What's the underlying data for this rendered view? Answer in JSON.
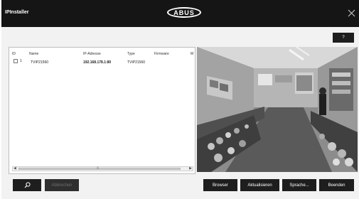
{
  "window": {
    "title": "IPInstaller",
    "logo_text": "ABUS",
    "close_icon": "close-x-icon"
  },
  "toolbar": {
    "help_label": "?"
  },
  "device_table": {
    "columns": [
      "ID",
      "Name",
      "IP-Adresse",
      "Type",
      "Firmware",
      "M"
    ],
    "rows": [
      {
        "id": "1",
        "name": "TVIP21560",
        "ip": "192.168.178.1:80",
        "type": "TVIP21560",
        "firmware": ""
      }
    ]
  },
  "preview": {
    "description_icon": "camera-preview-image"
  },
  "bottom_bar": {
    "search_icon": "search-icon",
    "cancel_label": "Abbrechen",
    "browser_label": "Browser",
    "refresh_label": "Aktualisieren",
    "language_label": "Sprache...",
    "exit_label": "Beenden"
  },
  "colors": {
    "titlebar": "#151515",
    "button": "#1e1e1e",
    "window_bg": "#f2f2f2"
  }
}
